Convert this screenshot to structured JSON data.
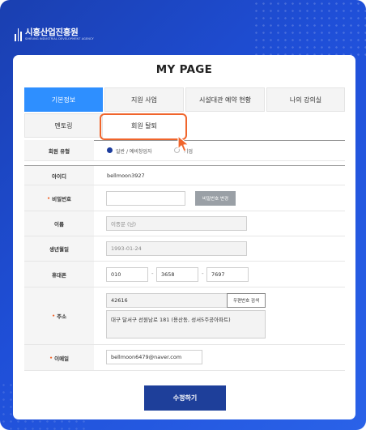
{
  "brand": {
    "name": "시흥산업진흥원",
    "subtitle": "SIHEUNG INDUSTRIAL DEVELOPMENT AGENCY"
  },
  "page": {
    "title": "MY PAGE"
  },
  "tabs": [
    {
      "label": "기본정보",
      "active": true
    },
    {
      "label": "지원 사업",
      "active": false
    },
    {
      "label": "시설대관 예약 현황",
      "active": false
    },
    {
      "label": "나의 강의실",
      "active": false
    },
    {
      "label": "멘토링",
      "active": false
    },
    {
      "label": "회원 탈퇴",
      "active": false
    }
  ],
  "form": {
    "member_type": {
      "label": "회원 유형",
      "options": [
        {
          "label": "일반 / 예비창업자",
          "checked": true
        },
        {
          "label": "기업",
          "checked": false
        }
      ]
    },
    "user_id": {
      "label": "아이디",
      "value": "bellmoon3927"
    },
    "password": {
      "label": "비밀번호",
      "required_mark": "•",
      "value": "",
      "button": "비밀번호 변경"
    },
    "name": {
      "label": "이름",
      "value": "이종문 (남)"
    },
    "birth": {
      "label": "생년월일",
      "value": "1993-01-24"
    },
    "phone": {
      "label": "휴대폰",
      "part1": "010",
      "part2": "3658",
      "part3": "7697",
      "sep": "-"
    },
    "address": {
      "label": "주소",
      "required_mark": "•",
      "zipcode": "42616",
      "zip_button": "우편번호 검색",
      "line1": "대구 달서구 선원남로 181 (용산동, 성서5주공아파트)",
      "line2": ""
    },
    "email": {
      "label": "이메일",
      "required_mark": "•",
      "value": "bellmoon6479@naver.com"
    },
    "submit": "수정하기"
  },
  "colors": {
    "accent": "#2e8fff",
    "navy": "#1e3f9a",
    "highlight": "#f0652c",
    "background": "#1f4fd8"
  }
}
